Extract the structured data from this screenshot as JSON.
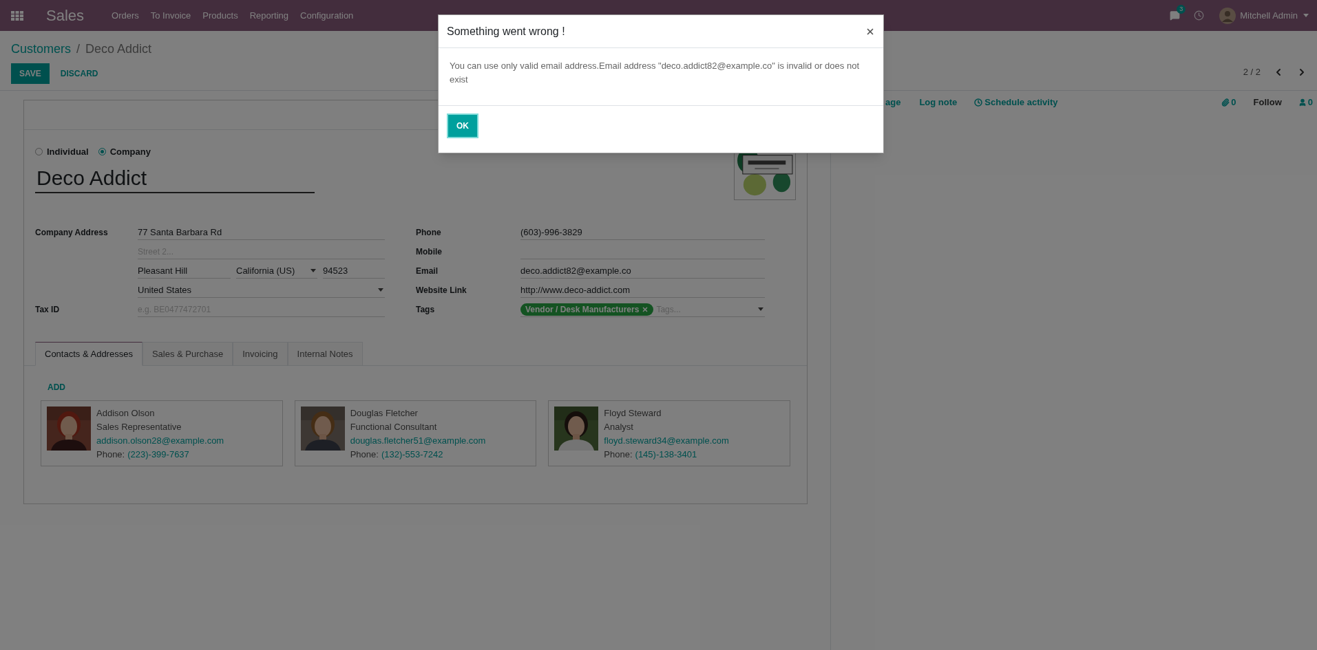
{
  "app_bar": {
    "app": "Sales",
    "menu": [
      "Orders",
      "To Invoice",
      "Products",
      "Reporting",
      "Configuration"
    ],
    "messages_badge": "3",
    "user": "Mitchell Admin"
  },
  "breadcrumb": {
    "parent": "Customers",
    "separator": "/",
    "current": "Deco Addict"
  },
  "actions": [
    "SAVE",
    "DISCARD"
  ],
  "pager": "2 / 2",
  "company_type": [
    {
      "label": "Individual",
      "selected": false
    },
    {
      "label": "Company",
      "selected": true
    }
  ],
  "name": "Deco Addict",
  "address": {
    "label": "Company Address",
    "street": "77 Santa Barbara Rd",
    "street2_placeholder": "Street 2...",
    "city": "Pleasant Hill",
    "state": "California (US)",
    "zip": "94523",
    "country": "United States"
  },
  "tax_id": {
    "label": "Tax ID",
    "placeholder": "e.g. BE0477472701"
  },
  "contact_fields": [
    {
      "label": "Phone",
      "value": "(603)-996-3829"
    },
    {
      "label": "Mobile"
    },
    {
      "label": "Email",
      "value": "deco.addict82@example.co"
    },
    {
      "label": "Website Link",
      "value": "http://www.deco-addict.com"
    }
  ],
  "tags": {
    "label": "Tags",
    "items": [
      "Vendor / Desk Manufacturers"
    ],
    "placeholder": "Tags..."
  },
  "tabs": [
    {
      "label": "Contacts & Addresses",
      "selected": true
    },
    {
      "label": "Sales & Purchase",
      "selected": false
    },
    {
      "label": "Invoicing",
      "selected": false
    },
    {
      "label": "Internal Notes",
      "selected": false
    }
  ],
  "add_label": "ADD",
  "contacts": [
    {
      "name": "Addison Olson",
      "title": "Sales Representative",
      "email": "addison.olson28@example.com",
      "phone_label": "Phone:",
      "phone": "(223)-399-7637"
    },
    {
      "name": "Douglas Fletcher",
      "title": "Functional Consultant",
      "email": "douglas.fletcher51@example.com",
      "phone_label": "Phone:",
      "phone": "(132)-553-7242"
    },
    {
      "name": "Floyd Steward",
      "title": "Analyst",
      "email": "floyd.steward34@example.com",
      "phone_label": "Phone:",
      "phone": "(145)-138-3401"
    }
  ],
  "chatter": {
    "send_message_fragment": "age",
    "log_note": "Log note",
    "schedule": "Schedule activity",
    "attachments": "0",
    "follow": "Follow",
    "followers": "0"
  },
  "dialog": {
    "title": "Something went wrong !",
    "message": "You can use only valid email address.Email address \"deco.addict82@example.co\" is invalid or does not exist",
    "button": "OK"
  }
}
